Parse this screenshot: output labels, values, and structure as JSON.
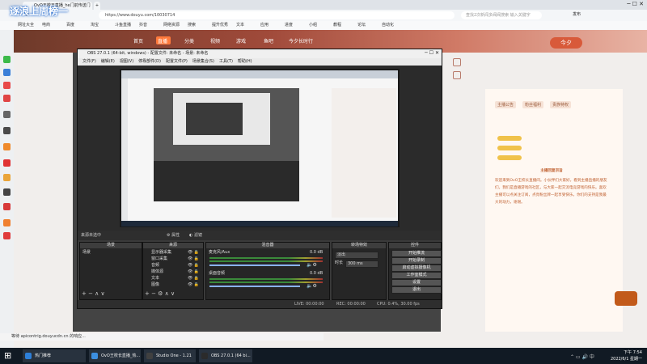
{
  "browser": {
    "tabs": [
      {
        "label": "OvO王校王直播_he门前传送门"
      },
      {
        "label": ""
      }
    ],
    "address": "https://www.douyu.com/10030714",
    "search_placeholder": "查找2次新闻多阀阀搜索 输入关键字",
    "user_label": "发布",
    "bookmarks": [
      "网址大全",
      "电商",
      "百度",
      "淘宝",
      "斗鱼直播",
      "抖音",
      "网络资源",
      "搜索",
      "提升优秀",
      "文本",
      "应用",
      "进度",
      "小组",
      "教程",
      "论坛",
      "自动化"
    ]
  },
  "streamer_title": "逐浪上周榜一",
  "douyu": {
    "nav": [
      "首页",
      "直播",
      "分类",
      "视频",
      "游戏",
      "鱼吧",
      "今夕长时行"
    ],
    "right_tabs": [
      "主播公告",
      "粉丝福利",
      "贵族特权"
    ],
    "notice_title": "主播回复宗旨",
    "notice_text": "欢迎来到OvO王校长直播间。小伙伴们大家好，看到主播直播的朋友们，我们是直播游戏的社区，与大家一起交流电竞游戏的快乐。喜欢主播可以点关注订阅，点亮粉丝牌一起享受快乐。你们的支持是我最大的动力，谢谢。",
    "badge_right": "今夕"
  },
  "obs": {
    "title": "OBS 27.0.1 (64-bit, windows) - 配置文件: 未命名 - 场景: 未命名",
    "menu": [
      "文件(F)",
      "编辑(E)",
      "视图(V)",
      "停靠部件(D)",
      "配置文件(P)",
      "场景集合(S)",
      "工具(T)",
      "帮助(H)"
    ],
    "preview_label": "来源未选中",
    "props_label": "属性",
    "filters_label": "滤镜",
    "docks": {
      "scenes": {
        "header": "场景",
        "items": [
          "场景"
        ]
      },
      "sources": {
        "header": "来源",
        "items": [
          "显示器采集",
          "窗口采集",
          "音频",
          "媒体源",
          "文本",
          "图像"
        ]
      },
      "mixer": {
        "header": "混音器",
        "tracks": [
          {
            "name": "桌面音频",
            "level": "0.0 dB"
          },
          {
            "name": "麦克风/Aux",
            "level": "0.0 dB"
          }
        ]
      },
      "transitions": {
        "header": "转场特效",
        "type": "淡出",
        "duration_label": "时长",
        "duration": "300 ms"
      },
      "controls": {
        "header": "控件",
        "buttons": [
          "开始推流",
          "开始录制",
          "启动虚拟摄像机",
          "工作室模式",
          "设置",
          "退出"
        ]
      }
    },
    "status": {
      "live": "LIVE: 00:00:00",
      "rec": "REC: 00:00:00",
      "cpu": "CPU: 0.4%, 30.00 fps"
    }
  },
  "statusline": "等待 apicontrig.douyucdn.cn 的响应...",
  "taskbar": {
    "items": [
      {
        "label": "热门推荐",
        "color": "#2d7fd8"
      },
      {
        "label": "OvO王校长直播_热...",
        "color": "#3c8fe0"
      },
      {
        "label": "Studio One - 1.21",
        "color": "#404040"
      },
      {
        "label": "OBS 27.0.1 (64 bi...",
        "color": "#2b2b2b"
      }
    ],
    "time": "下午 7:54",
    "date": "2022/6/1 星期一"
  },
  "colors": {
    "accent": "#ff7a3c",
    "obs_bg": "#2b2b2b",
    "taskbar": "#111a24"
  }
}
